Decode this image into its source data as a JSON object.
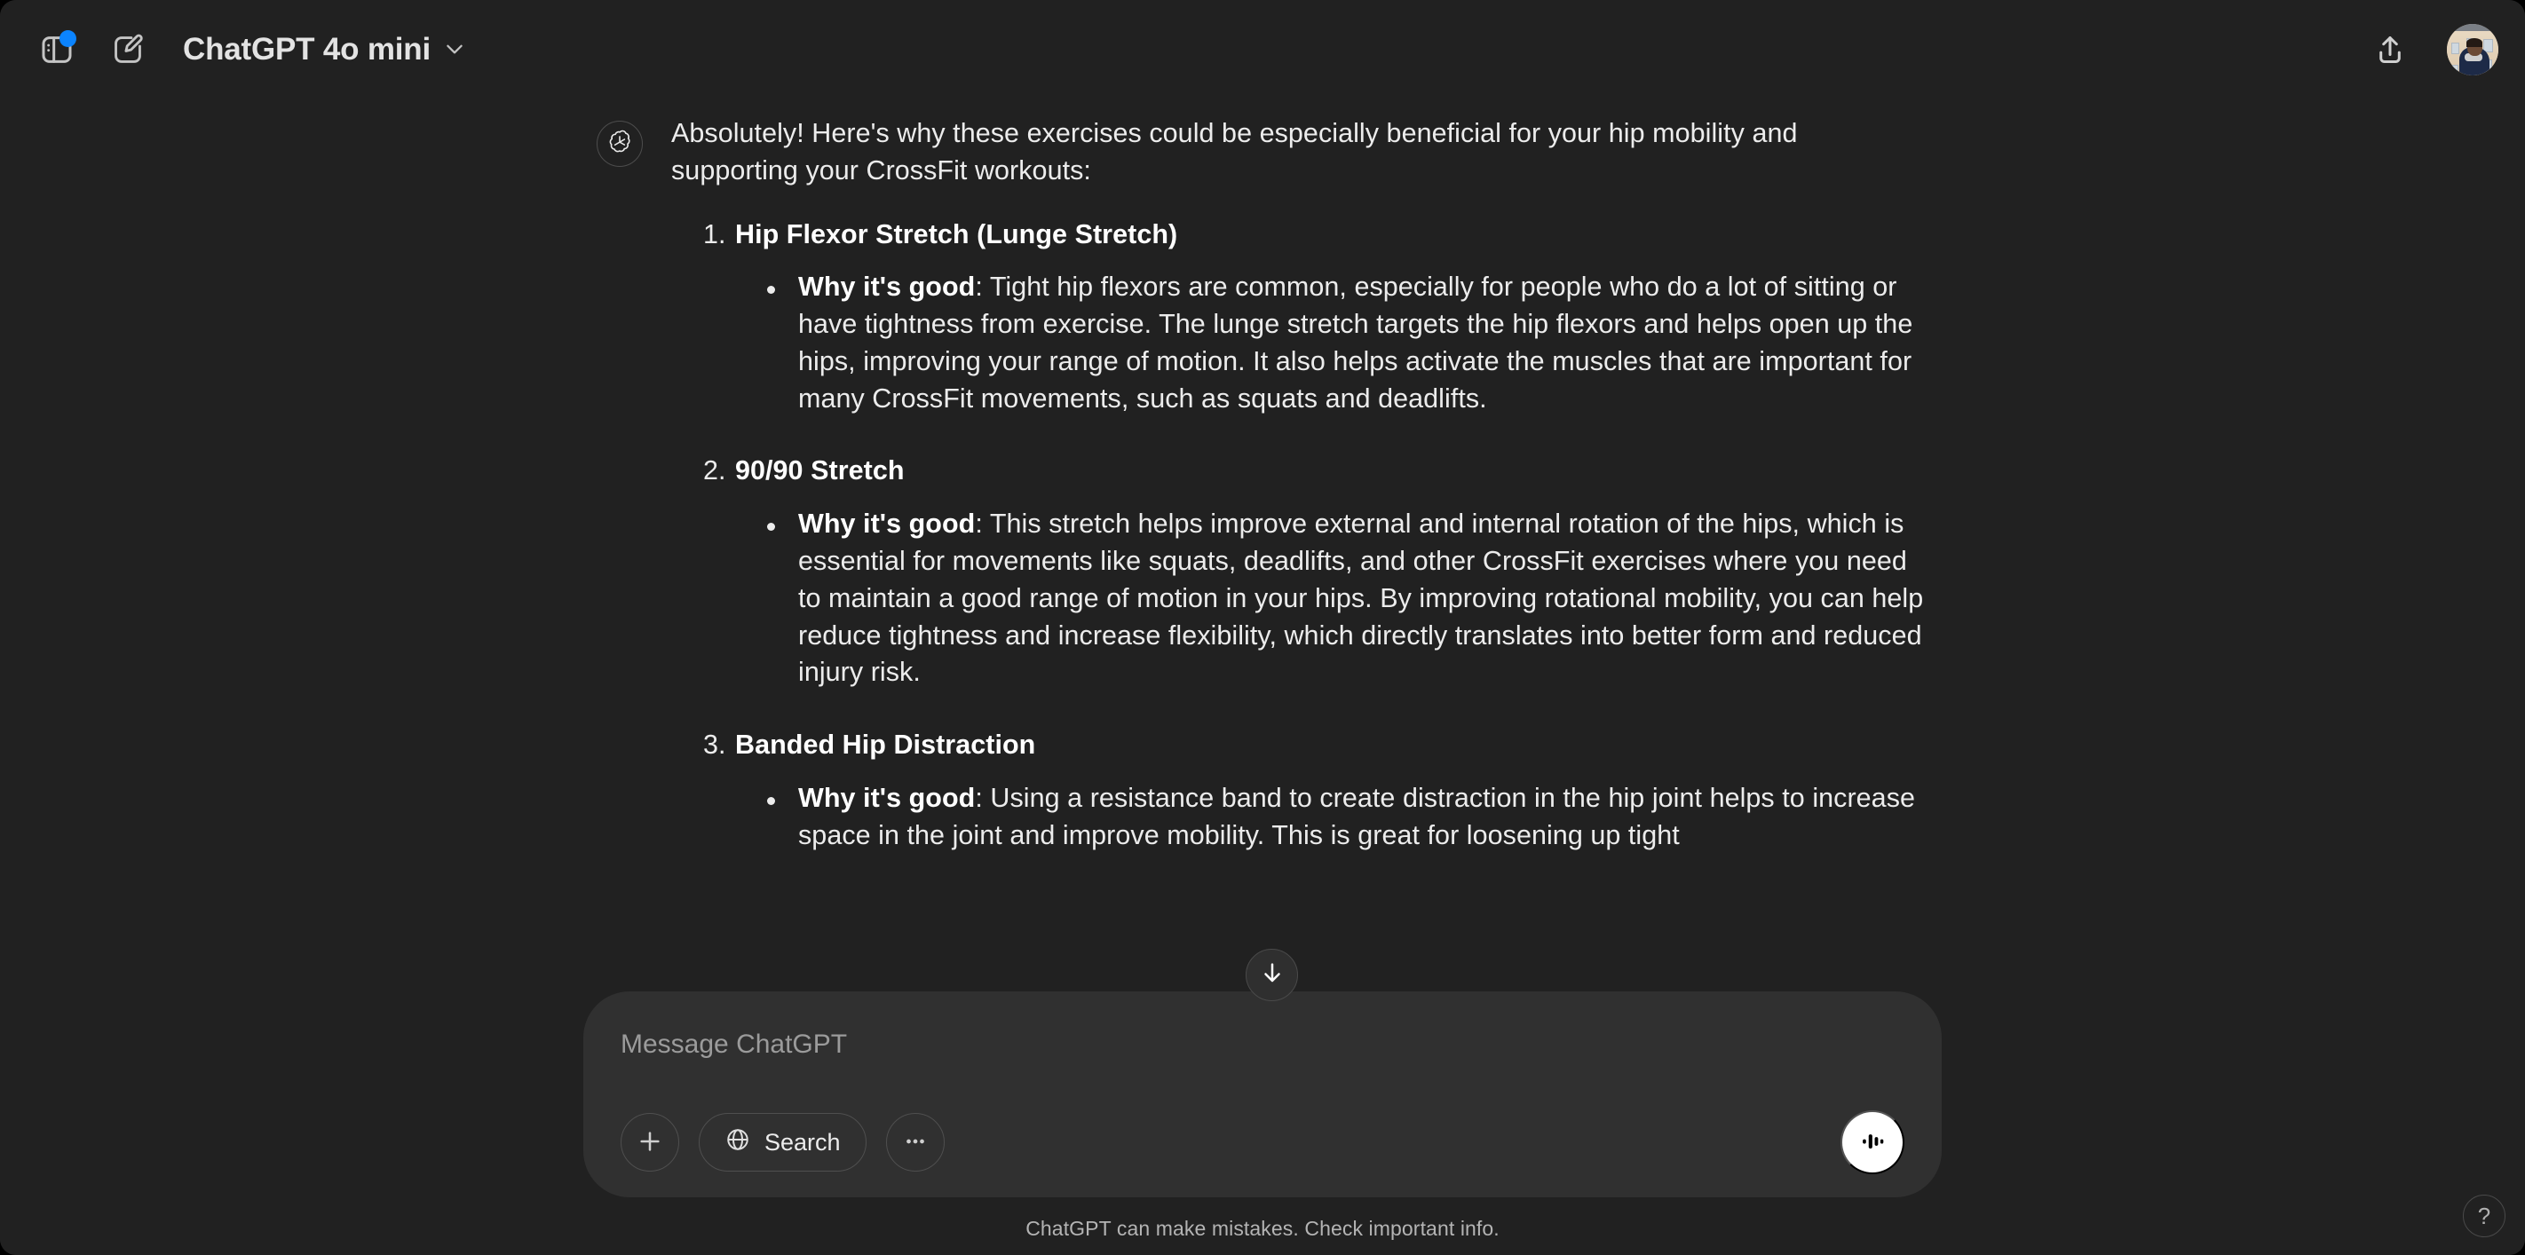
{
  "header": {
    "sidebar_toggle_icon": "sidebar-panel-icon",
    "has_notification_dot": true,
    "new_chat_icon": "compose-pencil-icon",
    "model_name": "ChatGPT 4o mini",
    "model_chevron_icon": "chevron-down-icon",
    "share_icon": "share-upload-icon",
    "avatar_alt": "user-profile-photo"
  },
  "conversation": {
    "assistant_avatar_icon": "openai-logo-icon",
    "intro": "Absolutely! Here's why these exercises could be especially beneficial for your hip mobility and supporting your CrossFit workouts:",
    "steps": [
      {
        "number": "1.",
        "title": "Hip Flexor Stretch (Lunge Stretch)",
        "bullets": [
          {
            "label": "Why it's good",
            "text": ": Tight hip flexors are common, especially for people who do a lot of sitting or have tightness from exercise. The lunge stretch targets the hip flexors and helps open up the hips, improving your range of motion. It also helps activate the muscles that are important for many CrossFit movements, such as squats and deadlifts."
          }
        ]
      },
      {
        "number": "2.",
        "title": "90/90 Stretch",
        "bullets": [
          {
            "label": "Why it's good",
            "text": ": This stretch helps improve external and internal rotation of the hips, which is essential for movements like squats, deadlifts, and other CrossFit exercises where you need to maintain a good range of motion in your hips. By improving rotational mobility, you can help reduce tightness and increase flexibility, which directly translates into better form and reduced injury risk."
          }
        ]
      },
      {
        "number": "3.",
        "title": "Banded Hip Distraction",
        "bullets": [
          {
            "label": "Why it's good",
            "text": ": Using a resistance band to create distraction in the hip joint helps to increase space in the joint and improve mobility. This is great for loosening up tight"
          }
        ]
      }
    ],
    "scroll_down_icon": "arrow-down-icon"
  },
  "composer": {
    "placeholder": "Message ChatGPT",
    "value": "",
    "attach_icon": "plus-icon",
    "search_icon": "globe-icon",
    "search_label": "Search",
    "more_icon": "ellipsis-icon",
    "voice_icon": "voice-waveform-icon"
  },
  "footer": {
    "disclaimer": "ChatGPT can make mistakes. Check important info.",
    "help_label": "?"
  },
  "colors": {
    "app_background": "#212121",
    "composer_background": "#303030",
    "accent_dot": "#0b84ff",
    "primary_text": "#ececec",
    "muted_text": "#b4b4b4",
    "voice_button": "#ffffff"
  }
}
